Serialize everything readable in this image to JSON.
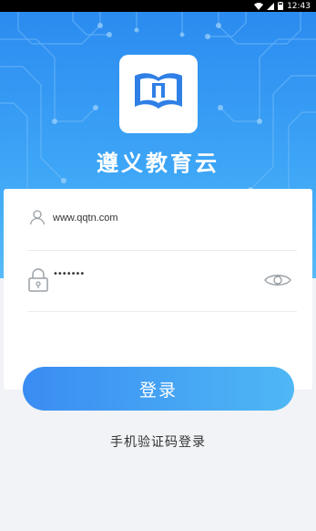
{
  "status_bar": {
    "time": "12:43"
  },
  "app": {
    "title": "遵义教育云"
  },
  "login_form": {
    "username_value": "www.qqtn.com",
    "password_value": "•••••••"
  },
  "actions": {
    "login_label": "登录",
    "sms_login_label": "手机验证码登录"
  },
  "colors": {
    "hero_gradient_top": "#2b8bf0",
    "hero_gradient_bottom": "#56bbf7",
    "button_gradient_start": "#3a8cf2",
    "button_gradient_end": "#4fb8f5",
    "background": "#f1f3f6"
  },
  "icons": [
    "wifi-icon",
    "signal-icon",
    "battery-icon",
    "book-logo-icon",
    "user-icon",
    "lock-icon",
    "eye-icon"
  ]
}
